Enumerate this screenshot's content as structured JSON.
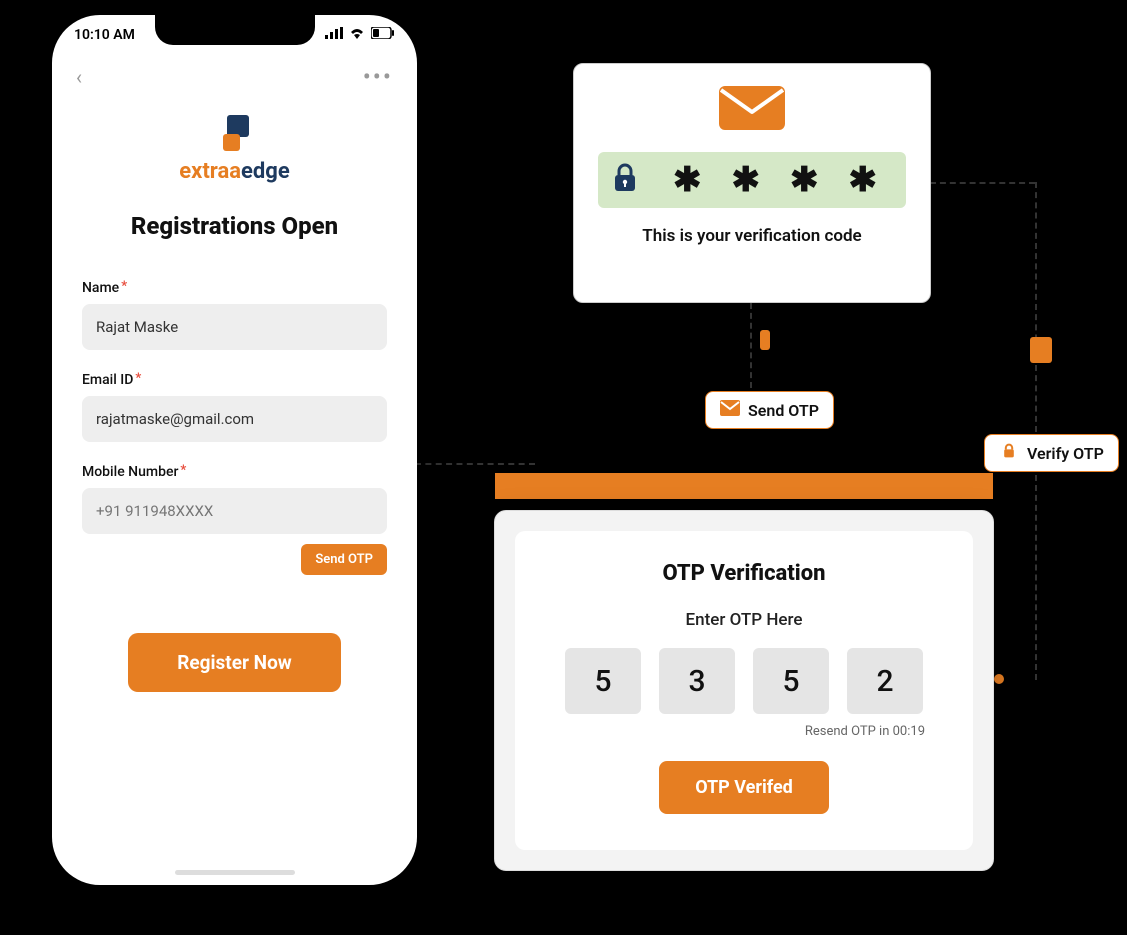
{
  "phone": {
    "time": "10:10 AM",
    "brand_prefix": "extraa",
    "brand_suffix": "edge",
    "heading": "Registrations Open",
    "name_label": "Name",
    "name_value": "Rajat Maske",
    "email_label": "Email ID",
    "email_value": "rajatmaske@gmail.com",
    "mobile_label": "Mobile Number",
    "mobile_placeholder": "+91 911948XXXX",
    "send_otp": "Send OTP",
    "register": "Register Now"
  },
  "verif": {
    "stars": [
      "✱",
      "✱",
      "✱",
      "✱"
    ],
    "caption": "This is your verification code"
  },
  "pills": {
    "send": "Send OTP",
    "verify": "Verify OTP"
  },
  "otp": {
    "title": "OTP Verification",
    "enter": "Enter OTP Here",
    "digits": [
      "5",
      "3",
      "5",
      "2"
    ],
    "resend": "Resend OTP in 00:19",
    "verified": "OTP Verifed"
  }
}
